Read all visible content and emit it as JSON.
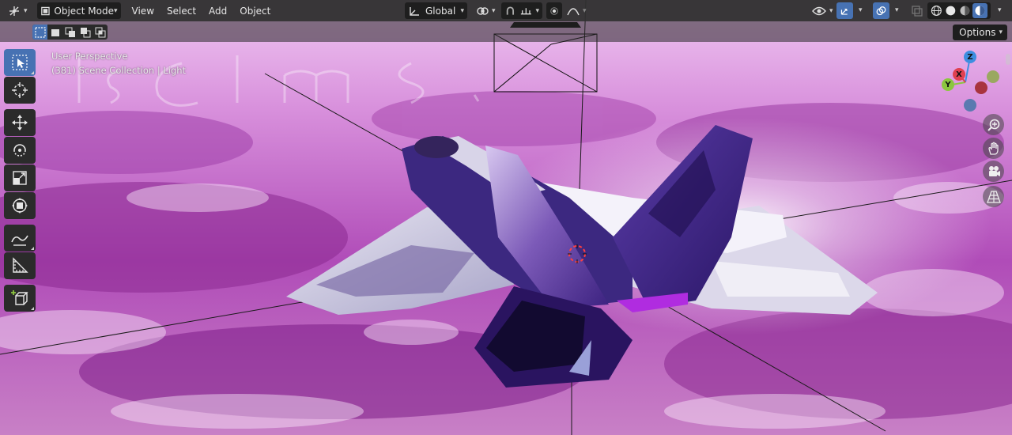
{
  "header": {
    "editor_type_icon": "editor-type-icon",
    "mode": "Object Mode",
    "menus": [
      "View",
      "Select",
      "Add",
      "Object"
    ],
    "transform_orientation": "Global"
  },
  "viewport": {
    "perspective_label": "User Perspective",
    "collection_label": "(381) Scene Collection | Light",
    "options_label": "Options"
  },
  "gizmo": {
    "z": "Z",
    "y": "Y",
    "x": "X"
  },
  "colors": {
    "accent": "#4772b3",
    "header": "#303030",
    "axis_x": "#e04050",
    "axis_y": "#8cc63f",
    "axis_z": "#3d8ee0"
  },
  "toolbar": {
    "tools": [
      "select-box-icon",
      "cursor-icon",
      "move-icon",
      "rotate-icon",
      "scale-icon",
      "transform-icon",
      "annotate-icon",
      "measure-icon",
      "add-cube-icon"
    ]
  }
}
